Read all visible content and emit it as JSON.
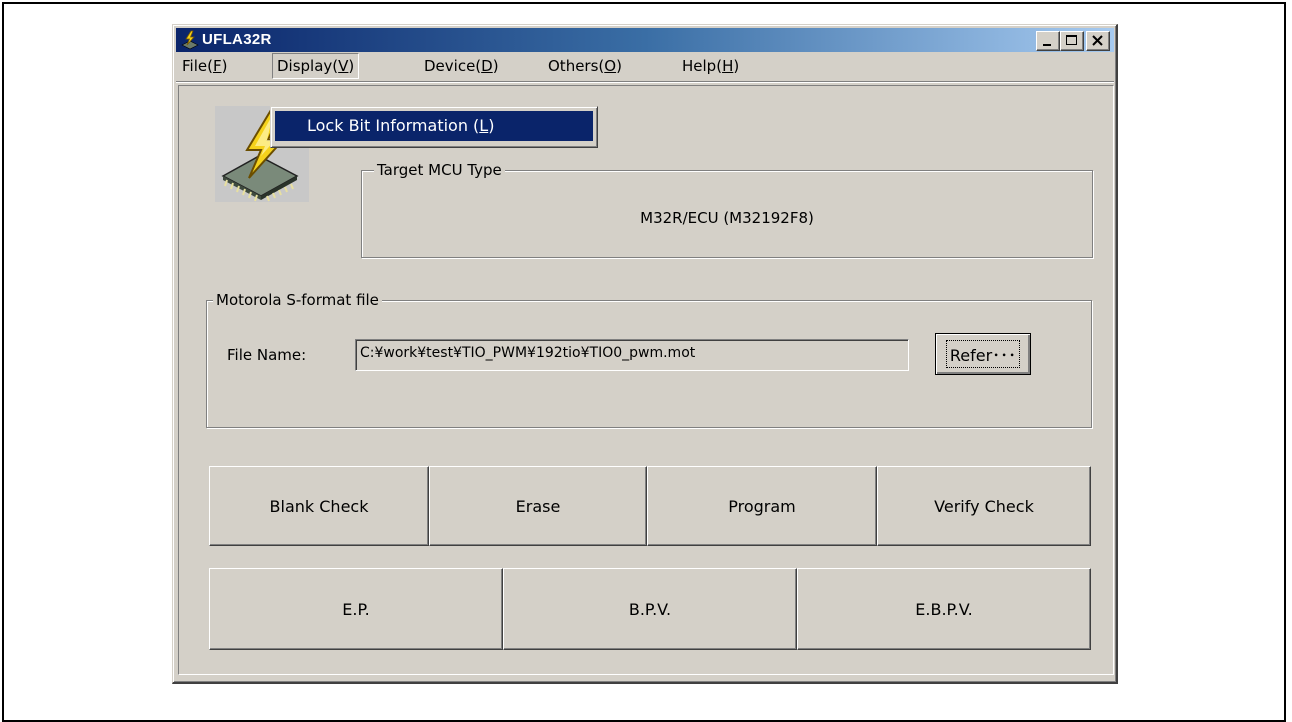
{
  "window": {
    "title": "UFLA32R",
    "icon": "lightning-chip-icon"
  },
  "menubar": {
    "items": [
      {
        "label": "File(",
        "key": "F",
        "end": ")"
      },
      {
        "label": "Display(",
        "key": "V",
        "end": ")"
      },
      {
        "label": "Device(",
        "key": "D",
        "end": ")"
      },
      {
        "label": "Others(",
        "key": "O",
        "end": ")"
      },
      {
        "label": "Help(",
        "key": "H",
        "end": ")"
      }
    ]
  },
  "display_menu": {
    "items": [
      {
        "label": "Lock Bit Information (",
        "key": "L",
        "end": ")"
      }
    ]
  },
  "target_mcu": {
    "label": "Target MCU Type",
    "value": "M32R/ECU (M32192F8)"
  },
  "file_group": {
    "label": "Motorola S-format file",
    "file_name_label": "File Name:",
    "file_name_value": "C:¥work¥test¥TIO_PWM¥192tio¥TIO0_pwm.mot",
    "refer_button": "Refer･･･"
  },
  "action_buttons": {
    "row1": [
      "Blank Check",
      "Erase",
      "Program",
      "Verify Check"
    ],
    "row2": [
      "E.P.",
      "B.P.V.",
      "E.B.P.V."
    ]
  },
  "colors": {
    "face": "#d4d0c8",
    "titlebar_start": "#0a246a",
    "titlebar_end": "#a6caf0",
    "highlight": "#0a246a"
  }
}
